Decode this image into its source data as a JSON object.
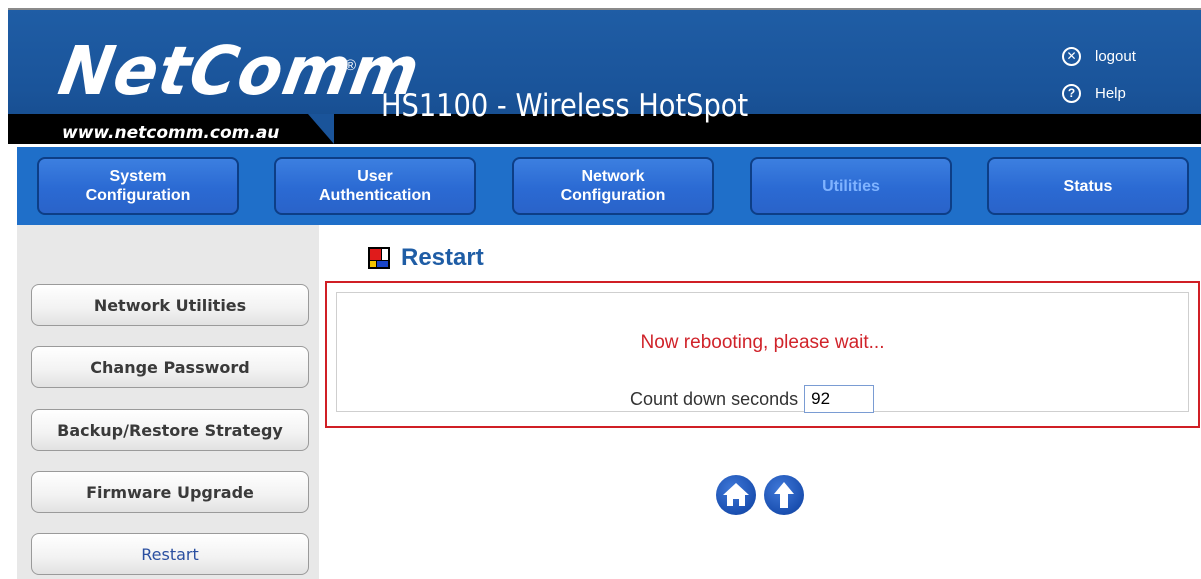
{
  "header": {
    "brand": "NetComm",
    "registered_mark": "®",
    "brand_url": "www.netcomm.com.au",
    "product_title": "HS1100 - Wireless HotSpot",
    "logout_label": "logout",
    "help_label": "Help"
  },
  "nav": {
    "tabs": [
      {
        "label": "System\nConfiguration",
        "active": false
      },
      {
        "label": "User\nAuthentication",
        "active": false
      },
      {
        "label": "Network\nConfiguration",
        "active": false
      },
      {
        "label": "Utilities",
        "active": true
      },
      {
        "label": "Status",
        "active": false
      }
    ]
  },
  "sidebar": {
    "items": [
      {
        "label": "Network Utilities"
      },
      {
        "label": "Change Password"
      },
      {
        "label": "Backup/Restore Strategy"
      },
      {
        "label": "Firmware Upgrade"
      },
      {
        "label": "Restart",
        "active": true
      }
    ]
  },
  "main": {
    "title": "Restart",
    "message": "Now rebooting, please wait...",
    "countdown_label": "Count down seconds",
    "countdown_value": "92"
  },
  "colors": {
    "header_blue": "#1a549a",
    "nav_blue": "#1f6fc9",
    "alert_red": "#d0232a"
  },
  "icons": {
    "logout": "close-circle-icon",
    "help": "question-circle-icon",
    "home": "home-icon",
    "up": "up-arrow-icon"
  }
}
